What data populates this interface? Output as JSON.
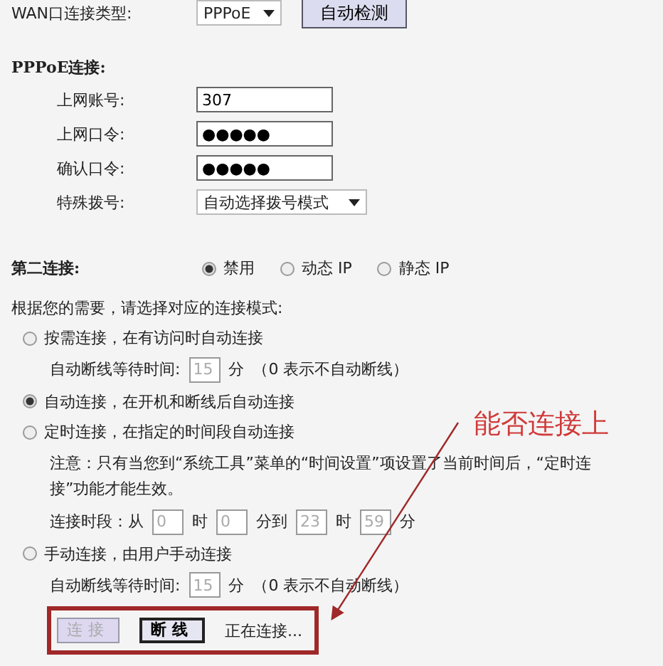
{
  "wan_type": {
    "label": "WAN口连接类型:",
    "value": "PPPoE",
    "button": "自动检测"
  },
  "pppoe": {
    "heading": "PPPoE连接:",
    "fields": [
      {
        "kind": "text",
        "label": "上网账号:",
        "value": "307"
      },
      {
        "kind": "text",
        "label": "上网口令:",
        "value": "●●●●●"
      },
      {
        "kind": "text",
        "label": "确认口令:",
        "value": "●●●●●"
      },
      {
        "kind": "select",
        "label": "特殊拨号:",
        "value": "自动选择拨号模式"
      }
    ]
  },
  "second_connection": {
    "label": "第二连接:",
    "options": [
      {
        "label": "禁用",
        "selected": true
      },
      {
        "label": "动态 IP",
        "selected": false
      },
      {
        "label": "静态 IP",
        "selected": false
      }
    ]
  },
  "mode_prompt": "根据您的需要，请选择对应的连接模式:",
  "modes": [
    {
      "label": "按需连接，在有访问时自动连接",
      "selected": false,
      "details": [
        [
          {
            "kind": "text",
            "text": "自动断线等待时间:"
          },
          {
            "kind": "input",
            "value": "15",
            "disabled": true
          },
          {
            "kind": "text",
            "text": "分"
          },
          {
            "kind": "text",
            "text": "（0 表示不自动断线）"
          }
        ]
      ]
    },
    {
      "label": "自动连接，在开机和断线后自动连接",
      "selected": true
    },
    {
      "label": "定时连接，在指定的时间段自动连接",
      "selected": false,
      "details": [
        [
          {
            "kind": "note",
            "text": "注意：只有当您到“系统工具”菜单的“时间设置”项设置了当前时间后，“定时连接”功能才能生效。"
          }
        ],
        [
          {
            "kind": "text",
            "text": "连接时段：从"
          },
          {
            "kind": "input",
            "value": "0",
            "disabled": true
          },
          {
            "kind": "text",
            "text": "时"
          },
          {
            "kind": "input",
            "value": "0",
            "disabled": true
          },
          {
            "kind": "text",
            "text": "分到"
          },
          {
            "kind": "input",
            "value": "23",
            "disabled": true
          },
          {
            "kind": "text",
            "text": "时"
          },
          {
            "kind": "input",
            "value": "59",
            "disabled": true
          },
          {
            "kind": "text",
            "text": "分"
          }
        ]
      ]
    },
    {
      "label": "手动连接，由用户手动连接",
      "selected": false,
      "details": [
        [
          {
            "kind": "text",
            "text": "自动断线等待时间:"
          },
          {
            "kind": "input",
            "value": "15",
            "disabled": true
          },
          {
            "kind": "text",
            "text": "分"
          },
          {
            "kind": "text",
            "text": "（0 表示不自动断线）"
          }
        ]
      ]
    }
  ],
  "actions": {
    "buttons": [
      {
        "label": "连接",
        "disabled": true
      },
      {
        "label": "断线",
        "disabled": false
      }
    ],
    "status": "正在连接..."
  },
  "annotation": {
    "text": "能否连接上"
  }
}
